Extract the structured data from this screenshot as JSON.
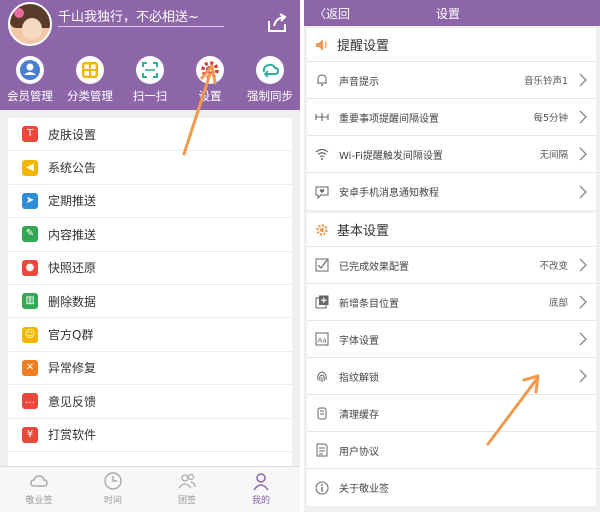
{
  "left": {
    "motto": "千山我独行，不必相送~",
    "quick_actions": [
      {
        "label": "会员管理",
        "icon": "user-icon"
      },
      {
        "label": "分类管理",
        "icon": "grid-icon"
      },
      {
        "label": "扫一扫",
        "icon": "scan-icon"
      },
      {
        "label": "设置",
        "icon": "gear-icon"
      },
      {
        "label": "强制同步",
        "icon": "sync-icon"
      }
    ],
    "menu": [
      {
        "label": "皮肤设置",
        "icon": "shirt-icon",
        "color": "#e8493b"
      },
      {
        "label": "系统公告",
        "icon": "speaker-icon",
        "color": "#f2b705"
      },
      {
        "label": "定期推送",
        "icon": "send-icon",
        "color": "#2e8fd6"
      },
      {
        "label": "内容推送",
        "icon": "edit-icon",
        "color": "#33a852"
      },
      {
        "label": "快照还原",
        "icon": "camera-icon",
        "color": "#e8493b"
      },
      {
        "label": "删除数据",
        "icon": "trash-icon",
        "color": "#33a852"
      },
      {
        "label": "官方Q群",
        "icon": "group-icon",
        "color": "#f2b705"
      },
      {
        "label": "异常修复",
        "icon": "wrench-icon",
        "color": "#ef7d22"
      },
      {
        "label": "意见反馈",
        "icon": "chat-icon",
        "color": "#e8493b"
      },
      {
        "label": "打赏软件",
        "icon": "gift-icon",
        "color": "#e8493b"
      }
    ],
    "tabs": [
      {
        "label": "敬业签",
        "icon": "cloud-icon"
      },
      {
        "label": "时间",
        "icon": "clock-icon"
      },
      {
        "label": "团签",
        "icon": "team-icon"
      },
      {
        "label": "我的",
        "icon": "profile-icon"
      }
    ],
    "colors": {
      "header": "#8d66a9",
      "arrow": "#ef9a4e"
    }
  },
  "right": {
    "back_label": "返回",
    "title": "设置",
    "reminder_section": {
      "title": "提醒设置",
      "rows": [
        {
          "label": "声音提示",
          "value": "音乐铃声1",
          "icon": "bell-icon"
        },
        {
          "label": "重要事项提醒间隔设置",
          "value": "每5分钟",
          "icon": "interval-icon"
        },
        {
          "label": "Wi-Fi提醒触发间隔设置",
          "value": "无间隔",
          "icon": "wifi-icon"
        },
        {
          "label": "安卓手机消息通知教程",
          "value": "",
          "icon": "heart-chat-icon"
        }
      ]
    },
    "basic_section": {
      "title": "基本设置",
      "rows": [
        {
          "label": "已完成效果配置",
          "value": "不改变",
          "icon": "checkbox-icon"
        },
        {
          "label": "新增条目位置",
          "value": "底部",
          "icon": "add-box-icon"
        },
        {
          "label": "字体设置",
          "value": "",
          "icon": "font-icon"
        },
        {
          "label": "指纹解锁",
          "value": "",
          "icon": "fingerprint-icon"
        },
        {
          "label": "清理缓存",
          "value": "",
          "icon": "clean-icon"
        },
        {
          "label": "用户协议",
          "value": "",
          "icon": "doc-icon"
        },
        {
          "label": "关于敬业签",
          "value": "",
          "icon": "info-icon"
        }
      ]
    }
  }
}
